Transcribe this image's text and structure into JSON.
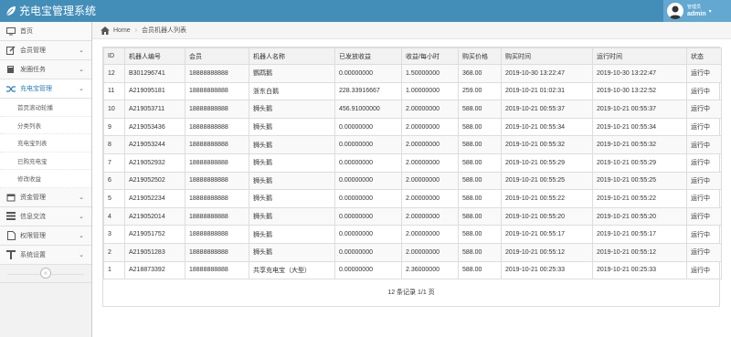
{
  "app": {
    "title": "充电宝管理系统"
  },
  "user": {
    "role": "管理员",
    "name": "admin"
  },
  "sidebar": {
    "items": [
      {
        "label": "首页",
        "icon": "monitor-icon"
      },
      {
        "label": "会员管理",
        "icon": "edit-icon"
      },
      {
        "label": "发圈任务",
        "icon": "book-icon"
      },
      {
        "label": "充电宝管理",
        "icon": "shuffle-icon"
      }
    ],
    "sub_items": [
      {
        "label": "首页滚动轮播"
      },
      {
        "label": "分类列表"
      },
      {
        "label": "充电宝列表"
      },
      {
        "label": "已购充电宝"
      },
      {
        "label": "修改收益"
      }
    ],
    "items_after": [
      {
        "label": "资金管理",
        "icon": "calendar-icon"
      },
      {
        "label": "信息交流",
        "icon": "list-icon"
      },
      {
        "label": "权限管理",
        "icon": "file-icon"
      },
      {
        "label": "系统设置",
        "icon": "tools-icon"
      }
    ]
  },
  "breadcrumb": {
    "home": "Home",
    "current": "会员机器人列表"
  },
  "table": {
    "headers": [
      "ID",
      "机器人编号",
      "会员",
      "机器人名称",
      "已发放收益",
      "收益/每小时",
      "购买价格",
      "购买时间",
      "运行时间",
      "状态"
    ],
    "rows": [
      [
        "12",
        "B301296741",
        "18888888888",
        "鹦鹉鹅",
        "0.00000000",
        "1.50000000",
        "368.00",
        "2019-10-30 13:22:47",
        "2019-10-30 13:22:47",
        "运行中"
      ],
      [
        "11",
        "A219095181",
        "18888888888",
        "浙东白鹅",
        "228.33916667",
        "1.00000000",
        "259.00",
        "2019-10-21 01:02:31",
        "2019-10-30 13:22:52",
        "运行中"
      ],
      [
        "10",
        "A219053711",
        "18888888888",
        "狮头鹅",
        "456.91000000",
        "2.00000000",
        "588.00",
        "2019-10-21 00:55:37",
        "2019-10-21 00:55:37",
        "运行中"
      ],
      [
        "9",
        "A219053436",
        "18888888888",
        "狮头鹅",
        "0.00000000",
        "2.00000000",
        "588.00",
        "2019-10-21 00:55:34",
        "2019-10-21 00:55:34",
        "运行中"
      ],
      [
        "8",
        "A219053244",
        "18888888888",
        "狮头鹅",
        "0.00000000",
        "2.00000000",
        "588.00",
        "2019-10-21 00:55:32",
        "2019-10-21 00:55:32",
        "运行中"
      ],
      [
        "7",
        "A219052932",
        "18888888888",
        "狮头鹅",
        "0.00000000",
        "2.00000000",
        "588.00",
        "2019-10-21 00:55:29",
        "2019-10-21 00:55:29",
        "运行中"
      ],
      [
        "6",
        "A219052502",
        "18888888888",
        "狮头鹅",
        "0.00000000",
        "2.00000000",
        "588.00",
        "2019-10-21 00:55:25",
        "2019-10-21 00:55:25",
        "运行中"
      ],
      [
        "5",
        "A219052234",
        "18888888888",
        "狮头鹅",
        "0.00000000",
        "2.00000000",
        "588.00",
        "2019-10-21 00:55:22",
        "2019-10-21 00:55:22",
        "运行中"
      ],
      [
        "4",
        "A219052014",
        "18888888888",
        "狮头鹅",
        "0.00000000",
        "2.00000000",
        "588.00",
        "2019-10-21 00:55:20",
        "2019-10-21 00:55:20",
        "运行中"
      ],
      [
        "3",
        "A219051752",
        "18888888888",
        "狮头鹅",
        "0.00000000",
        "2.00000000",
        "588.00",
        "2019-10-21 00:55:17",
        "2019-10-21 00:55:17",
        "运行中"
      ],
      [
        "2",
        "A219051283",
        "18888888888",
        "狮头鹅",
        "0.00000000",
        "2.00000000",
        "588.00",
        "2019-10-21 00:55:12",
        "2019-10-21 00:55:12",
        "运行中"
      ],
      [
        "1",
        "A218873392",
        "18888888888",
        "共享充电宝（大型）",
        "0.00000000",
        "2.36000000",
        "588.00",
        "2019-10-21 00:25:33",
        "2019-10-21 00:25:33",
        "运行中"
      ]
    ],
    "summary": "12 条记录 1/1 页"
  },
  "colors": {
    "header_bg": "#438eb9",
    "user_bg": "#62a8d1",
    "active_text": "#2b7dbc"
  }
}
